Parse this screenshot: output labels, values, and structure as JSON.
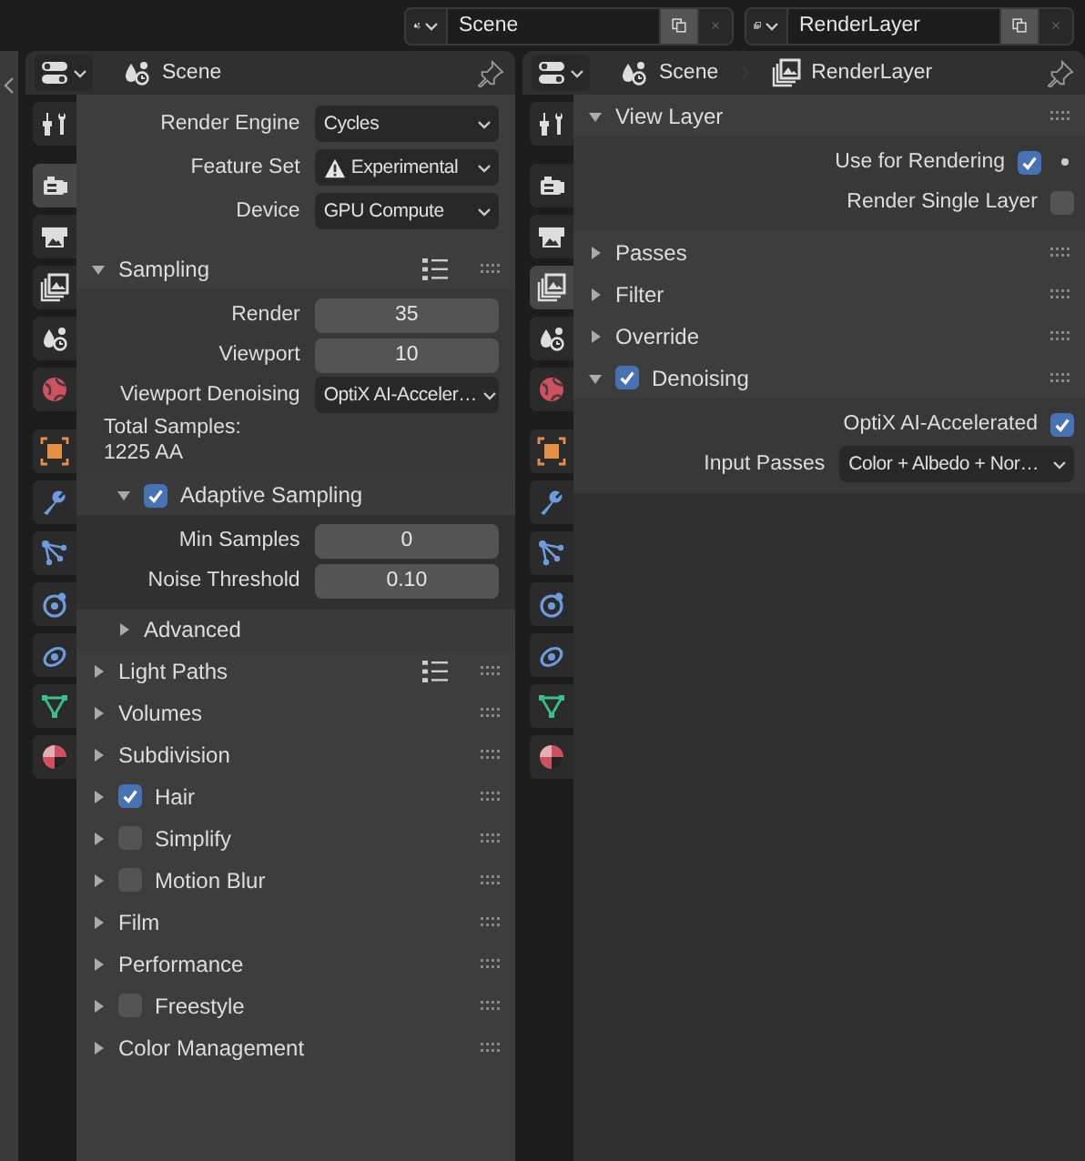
{
  "top_bar": {
    "selectors": [
      {
        "kind": "scene",
        "value": "Scene"
      },
      {
        "kind": "view_layer",
        "value": "RenderLayer"
      }
    ]
  },
  "editors": [
    {
      "breadcrumb": [
        {
          "kind": "scene",
          "label": "Scene"
        }
      ],
      "tab_groups": [
        {
          "tabs": [
            {
              "kind": "tool",
              "selected": false
            }
          ]
        },
        {
          "tabs": [
            {
              "kind": "render",
              "selected": true
            },
            {
              "kind": "output",
              "selected": false
            },
            {
              "kind": "view_layer",
              "selected": false
            },
            {
              "kind": "scene",
              "selected": false
            },
            {
              "kind": "world",
              "selected": false
            }
          ]
        },
        {
          "tabs": [
            {
              "kind": "object",
              "selected": false
            },
            {
              "kind": "modifier",
              "selected": false
            },
            {
              "kind": "particles",
              "selected": false
            },
            {
              "kind": "physics",
              "selected": false
            },
            {
              "kind": "constraints",
              "selected": false
            },
            {
              "kind": "data",
              "selected": false
            },
            {
              "kind": "material",
              "selected": false
            }
          ]
        }
      ],
      "rows": [
        {
          "kind": "dropdown",
          "label": "Render Engine",
          "value": "Cycles"
        },
        {
          "kind": "dropdown",
          "label": "Feature Set",
          "value": "Experimental",
          "warning": true
        },
        {
          "kind": "dropdown",
          "label": "Device",
          "value": "GPU Compute"
        }
      ],
      "panels": [
        {
          "title": "Sampling",
          "expanded": true,
          "presets": true,
          "rows": [
            {
              "kind": "number",
              "label": "Render",
              "value": "35"
            },
            {
              "kind": "number",
              "label": "Viewport",
              "value": "10"
            },
            {
              "kind": "dropdown",
              "label": "Viewport Denoising",
              "value": "OptiX AI-Acceler…"
            },
            {
              "kind": "text",
              "text": "Total Samples:"
            },
            {
              "kind": "text",
              "text": "1225 AA"
            }
          ],
          "subpanels": [
            {
              "title": "Adaptive Sampling",
              "expanded": true,
              "checked": true,
              "rows": [
                {
                  "kind": "number",
                  "label": "Min Samples",
                  "value": "0"
                },
                {
                  "kind": "number",
                  "label": "Noise Threshold",
                  "value": "0.10"
                }
              ]
            },
            {
              "title": "Advanced",
              "expanded": false
            }
          ]
        },
        {
          "title": "Light Paths",
          "expanded": false,
          "presets": true
        },
        {
          "title": "Volumes",
          "expanded": false
        },
        {
          "title": "Subdivision",
          "expanded": false
        },
        {
          "title": "Hair",
          "expanded": false,
          "checked": true
        },
        {
          "title": "Simplify",
          "expanded": false,
          "checked": false
        },
        {
          "title": "Motion Blur",
          "expanded": false,
          "checked": false
        },
        {
          "title": "Film",
          "expanded": false
        },
        {
          "title": "Performance",
          "expanded": false
        },
        {
          "title": "Freestyle",
          "expanded": false,
          "checked": false
        },
        {
          "title": "Color Management",
          "expanded": false
        }
      ]
    },
    {
      "breadcrumb": [
        {
          "kind": "scene",
          "label": "Scene"
        },
        {
          "kind": "view_layer",
          "label": "RenderLayer"
        }
      ],
      "tab_groups": [
        {
          "tabs": [
            {
              "kind": "tool",
              "selected": false
            }
          ]
        },
        {
          "tabs": [
            {
              "kind": "render",
              "selected": false
            },
            {
              "kind": "output",
              "selected": false
            },
            {
              "kind": "view_layer",
              "selected": true
            },
            {
              "kind": "scene",
              "selected": false
            },
            {
              "kind": "world",
              "selected": false
            }
          ]
        },
        {
          "tabs": [
            {
              "kind": "object",
              "selected": false
            },
            {
              "kind": "modifier",
              "selected": false
            },
            {
              "kind": "particles",
              "selected": false
            },
            {
              "kind": "physics",
              "selected": false
            },
            {
              "kind": "constraints",
              "selected": false
            },
            {
              "kind": "data",
              "selected": false
            },
            {
              "kind": "material",
              "selected": false
            }
          ]
        }
      ],
      "panels": [
        {
          "title": "View Layer",
          "expanded": true,
          "rows": [
            {
              "kind": "checkbox",
              "label": "Use for Rendering",
              "checked": true,
              "keyframe_dot": true
            },
            {
              "kind": "checkbox",
              "label": "Render Single Layer",
              "checked": false
            }
          ]
        },
        {
          "title": "Passes",
          "expanded": false
        },
        {
          "title": "Filter",
          "expanded": false
        },
        {
          "title": "Override",
          "expanded": false
        },
        {
          "title": "Denoising",
          "expanded": true,
          "checked": true,
          "rows": [
            {
              "kind": "checkbox",
              "label": "OptiX AI-Accelerated",
              "checked": true
            },
            {
              "kind": "dropdown",
              "label": "Input Passes",
              "value": "Color + Albedo + Nor…"
            }
          ]
        }
      ]
    }
  ]
}
